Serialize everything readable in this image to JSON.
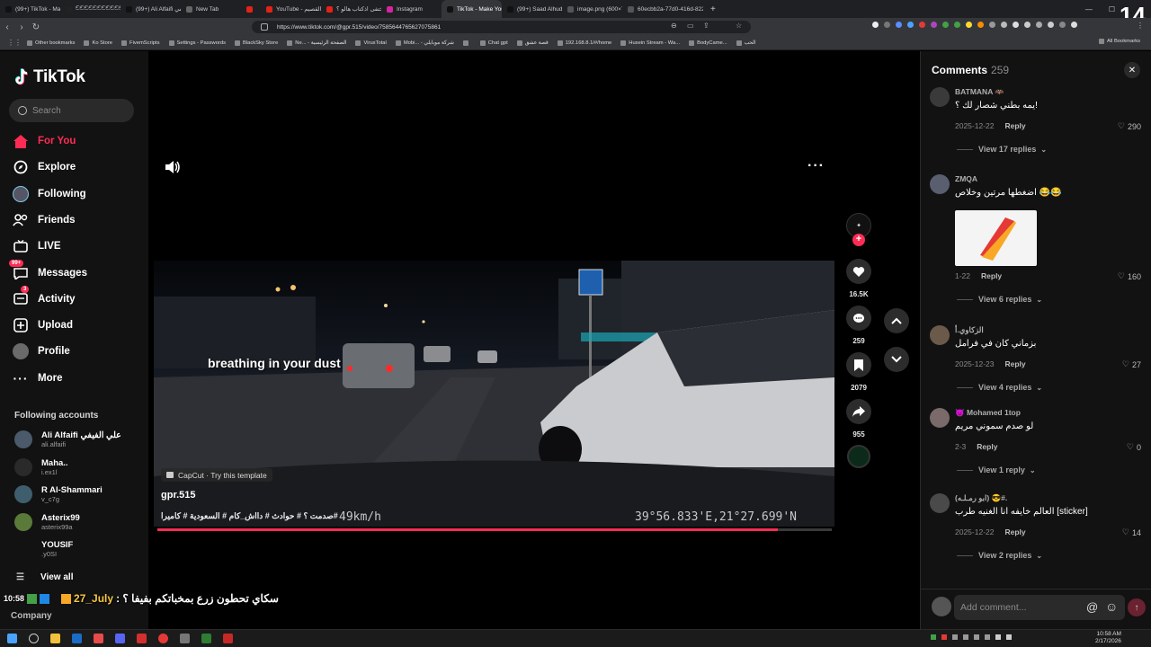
{
  "browser": {
    "tabs": [
      {
        "title": "(99+) TikTok - Make Your Day",
        "color": "#111",
        "active": false
      },
      {
        "title": "ඞඞඞඞඞඞඞඞඞඞඞඞඞඞඞ",
        "color": "#222",
        "active": false
      },
      {
        "title": "(99+) Ali Alfaifi علي الفيفي (@",
        "color": "#111",
        "active": false
      },
      {
        "title": "New Tab",
        "color": "#666",
        "active": false
      },
      {
        "title": "",
        "color": "#e62117",
        "active": false
      },
      {
        "title": "YouTube - والكلب القصيم",
        "color": "#e62117",
        "active": false
      },
      {
        "title": "ان اختفى اذكتاب هالو ؟ - YouTube",
        "color": "#e62117",
        "active": false
      },
      {
        "title": "Instagram",
        "color": "#d6249f",
        "active": false
      },
      {
        "title": "TikTok - Make Your Day",
        "color": "#111",
        "active": true
      },
      {
        "title": "(99+) Saad Alhudaithy (@saad",
        "color": "#111",
        "active": false
      },
      {
        "title": "image.png (600×791)",
        "color": "#555",
        "active": false
      },
      {
        "title": "60ecbb2a-77d0-416d-8225-4",
        "color": "#555",
        "active": false
      }
    ],
    "new_tab_label": "+",
    "url": "https://www.tiktok.com/@gpr.515/video/7585644765627075861",
    "bookmarks": [
      "Other bookmarks",
      "Ko Store",
      "FivemScripts",
      "Settings - Passwords",
      "BlackSky Store",
      "Ne... - الصفحة الرئيسية",
      "VirusTotal",
      "Mobi... - شركة موبايلي",
      "",
      "Chat gpt",
      "قصة عشق",
      "192.168.8.1/#/home",
      "Husein Stream - Wa...",
      "BodyCame...",
      "الحب"
    ],
    "all_bookmarks": "All Bookmarks",
    "stream_overlay_number": "14"
  },
  "sidebar": {
    "logo": "TikTok",
    "search_placeholder": "Search",
    "nav": [
      {
        "label": "For You",
        "icon": "home-icon",
        "active": true
      },
      {
        "label": "Explore",
        "icon": "compass-icon"
      },
      {
        "label": "Following",
        "icon": "following-icon"
      },
      {
        "label": "Friends",
        "icon": "friends-icon"
      },
      {
        "label": "LIVE",
        "icon": "live-icon"
      },
      {
        "label": "Messages",
        "icon": "messages-icon",
        "badge": "99+"
      },
      {
        "label": "Activity",
        "icon": "activity-icon",
        "badge": "3"
      },
      {
        "label": "Upload",
        "icon": "upload-icon"
      },
      {
        "label": "Profile",
        "icon": "profile-icon"
      },
      {
        "label": "More",
        "icon": "more-icon"
      }
    ],
    "following_title": "Following accounts",
    "following": [
      {
        "name": "Ali Alfaifi علي الفيفي",
        "handle": "ali.alfaifi"
      },
      {
        "name": "Maha..",
        "handle": "i.ex1l"
      },
      {
        "name": "R Al-Shammari",
        "handle": "v_c7g"
      },
      {
        "name": "Asterix99",
        "handle": "asterix99a"
      },
      {
        "name": "YOUSIF",
        "handle": ".y0SI"
      }
    ],
    "view_all": "View all",
    "company": "Company"
  },
  "video": {
    "caption_overlay": "breathing in your dust",
    "capcut": "CapCut · Try this template",
    "author": "gpr.515",
    "description": "#صدمت ؟ # حوادث # دااش_كام # السعودية # كاميرا",
    "speed": "49km/h",
    "coords": "39°56.833'E,21°27.699'N",
    "progress": 0.92
  },
  "actions": {
    "follow_plus": "+",
    "likes": "16.5K",
    "comments": "259",
    "saves": "2079",
    "shares": "955"
  },
  "comments": {
    "title": "Comments",
    "count": "259",
    "list": [
      {
        "user": "BATMANA 🦇",
        "text": "يمه بطني شصار لك ؟!",
        "date": "2025-12-22",
        "reply": "Reply",
        "likes": "290",
        "view": "View 17 replies"
      },
      {
        "user": "ZMQA",
        "text": "اضغطها مرتين وخلاص 😂😂",
        "date": "1-22",
        "reply": "Reply",
        "likes": "160",
        "view": "View 6 replies"
      },
      {
        "user": "الزكاوي.أ",
        "text": "بزماني كان في فرامل",
        "date": "2025-12-23",
        "reply": "Reply",
        "likes": "27",
        "view": "View 4 replies"
      },
      {
        "user": "😈 Mohamed 1top",
        "text": "لو صدم سموني مريم",
        "date": "2-3",
        "reply": "Reply",
        "likes": "0",
        "view": "View 1 reply"
      },
      {
        "user": "(ابو رمـلـه) 😎#.",
        "text": "العالم خايفه انا الغنيه طرب [sticker]",
        "date": "2025-12-22",
        "reply": "Reply",
        "likes": "14",
        "view": "View 2 replies"
      }
    ],
    "input_placeholder": "Add comment...",
    "at": "@",
    "emoji": "☺",
    "send": "↑"
  },
  "stream_chat": {
    "time": "10:58",
    "user": "27_July",
    "message": "سكاي تحطون زرع بمخباتكم بفيفا ؟ :"
  },
  "taskbar": {
    "clock": "10:58 AM",
    "date": "2/17/2026"
  }
}
